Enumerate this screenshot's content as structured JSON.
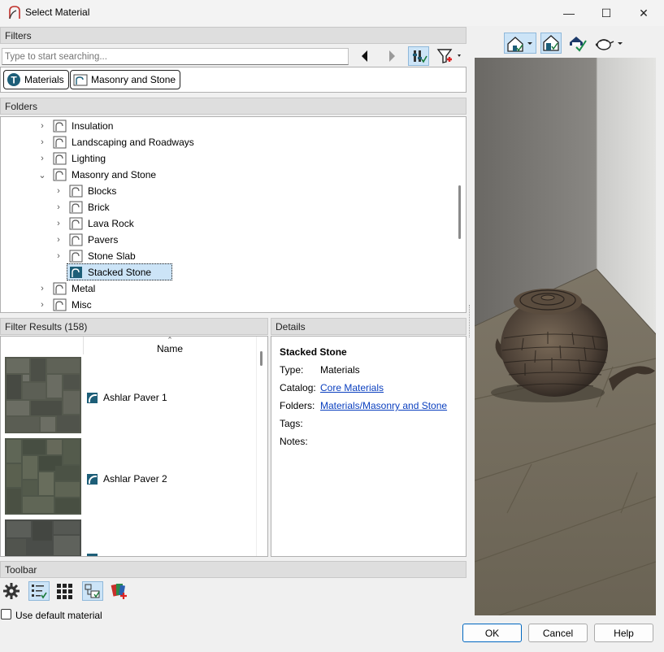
{
  "window": {
    "title": "Select Material",
    "minimize": "—",
    "maximize": "☐",
    "close": "✕"
  },
  "filters": {
    "header": "Filters",
    "search_placeholder": "Type to start searching...",
    "chips": [
      "Materials",
      "Masonry and Stone"
    ]
  },
  "folders": {
    "header": "Folders",
    "items": [
      {
        "label": "Insulation",
        "expanded": false
      },
      {
        "label": "Landscaping and Roadways",
        "expanded": false
      },
      {
        "label": "Lighting",
        "expanded": false
      },
      {
        "label": "Masonry and Stone",
        "expanded": true
      },
      {
        "label": "Blocks",
        "expanded": false
      },
      {
        "label": "Brick",
        "expanded": false
      },
      {
        "label": "Lava Rock",
        "expanded": false
      },
      {
        "label": "Pavers",
        "expanded": false
      },
      {
        "label": "Stone Slab",
        "expanded": false
      },
      {
        "label": "Stacked Stone",
        "selected": true
      },
      {
        "label": "Metal",
        "expanded": false
      },
      {
        "label": "Misc",
        "expanded": false
      }
    ]
  },
  "results": {
    "header": "Filter Results (158)",
    "column_name": "Name",
    "items": [
      {
        "name": "Ashlar Paver 1"
      },
      {
        "name": "Ashlar Paver 2"
      }
    ]
  },
  "details": {
    "header": "Details",
    "title": "Stacked Stone",
    "type_label": "Type:",
    "type_value": "Materials",
    "catalog_label": "Catalog:",
    "catalog_value": "Core Materials",
    "folders_label": "Folders:",
    "folders_value": "Materials/Masonry and Stone",
    "tags_label": "Tags:",
    "notes_label": "Notes:"
  },
  "toolbar": {
    "header": "Toolbar",
    "icons": [
      "gear-icon",
      "list-view-icon",
      "grid-view-icon",
      "tree-view-icon",
      "add-material-icon"
    ]
  },
  "use_default": {
    "label": "Use default material",
    "checked": false
  },
  "buttons": {
    "ok": "OK",
    "cancel": "Cancel",
    "help": "Help"
  },
  "colors": {
    "selection": "#cce4f7",
    "link": "#0a3fbf",
    "icon_teal": "#1d5e78"
  }
}
